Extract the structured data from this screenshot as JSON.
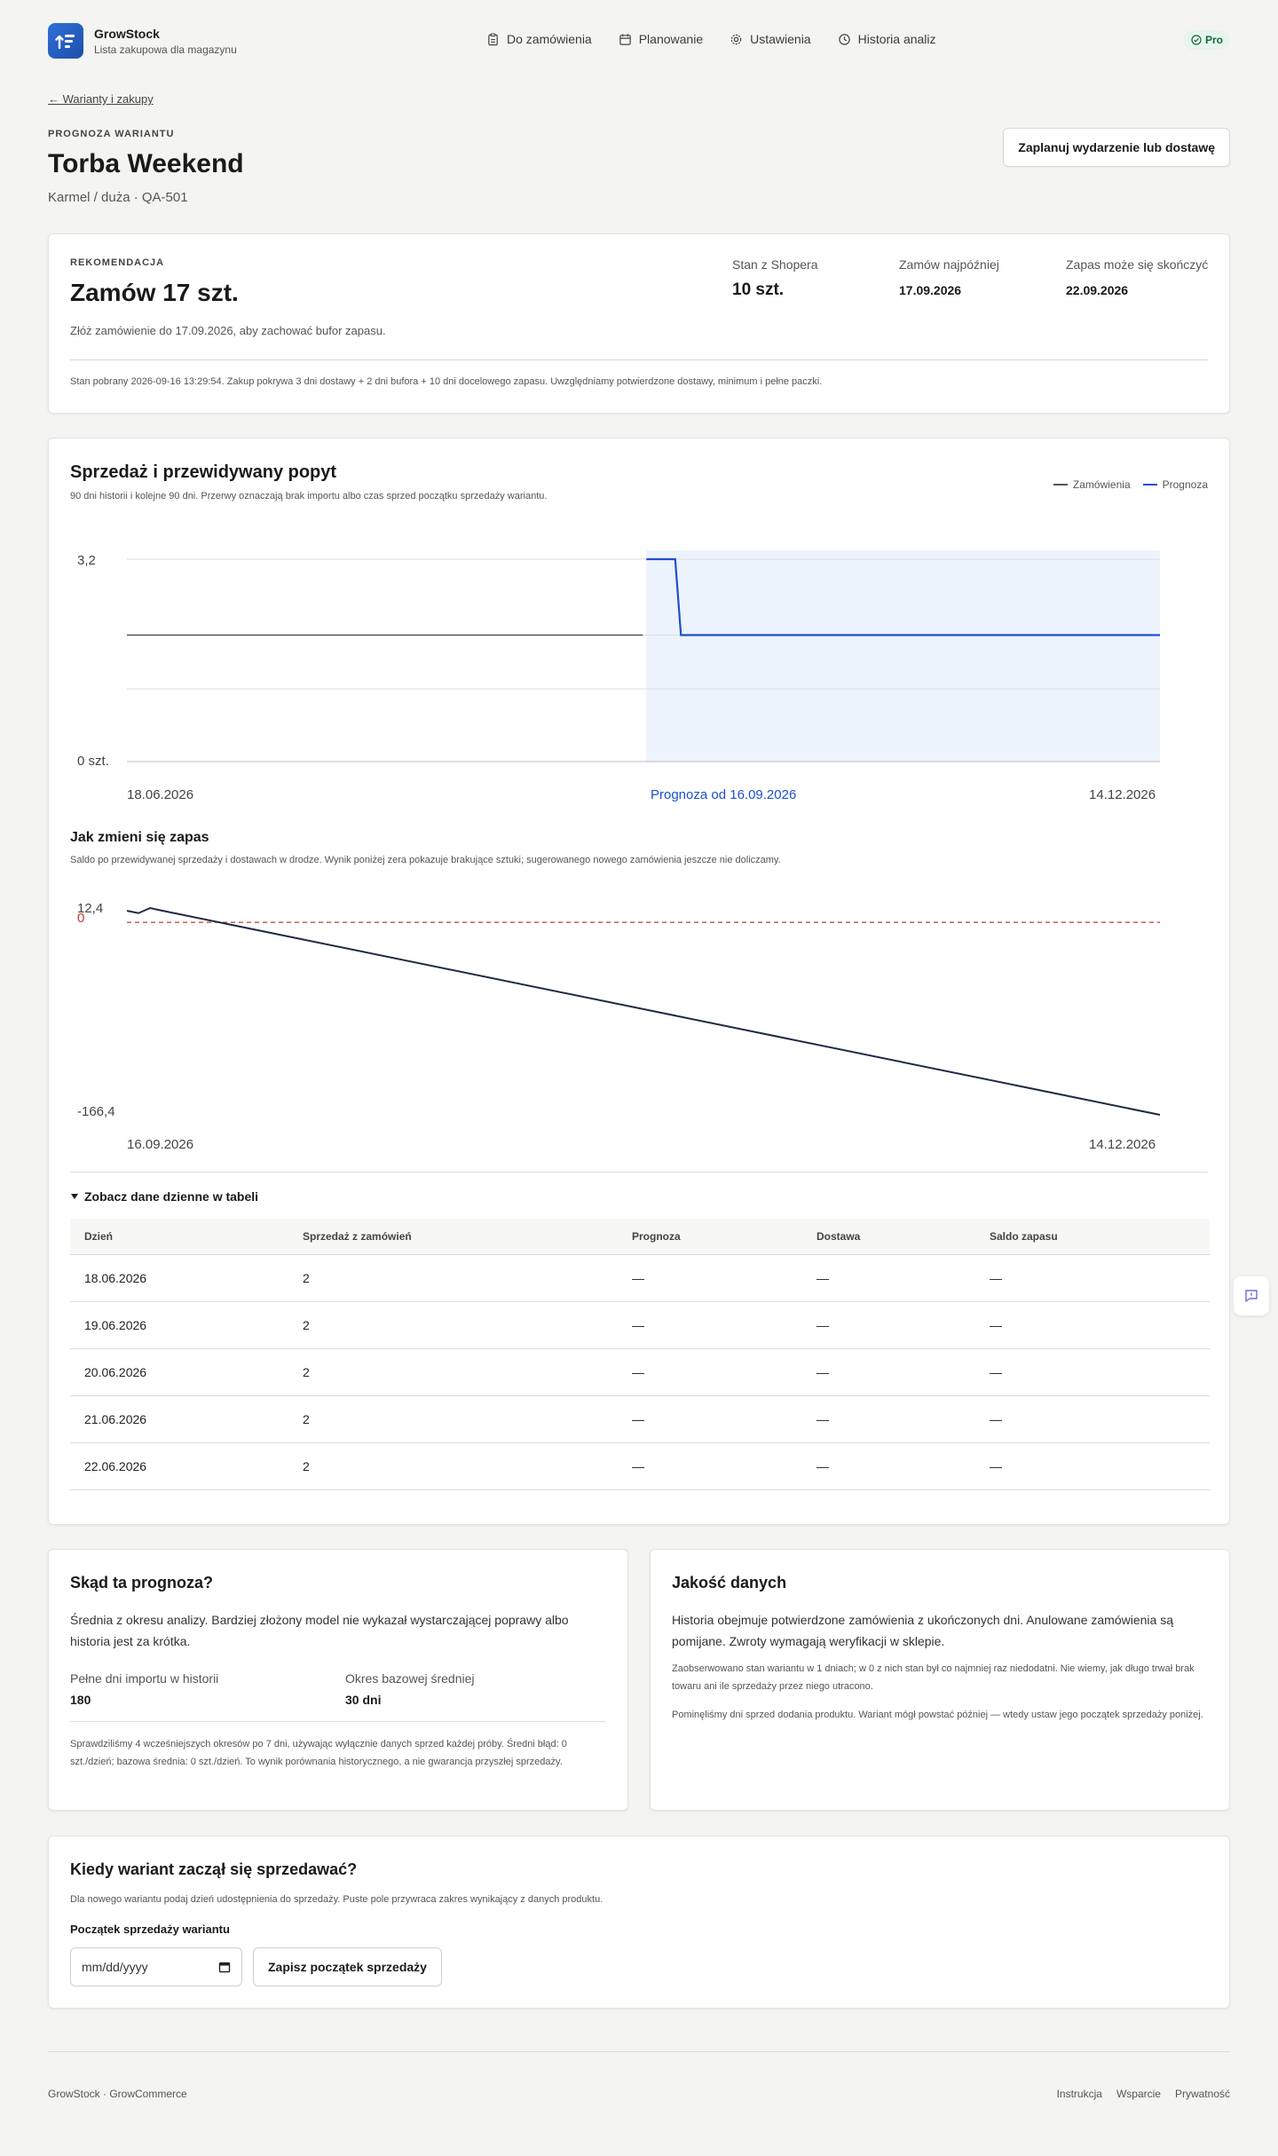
{
  "brand": {
    "name": "GrowStock",
    "tagline": "Lista zakupowa dla magazynu"
  },
  "nav": [
    {
      "label": "Do zamówienia",
      "icon": "clipboard-icon"
    },
    {
      "label": "Planowanie",
      "icon": "calendar-icon"
    },
    {
      "label": "Ustawienia",
      "icon": "gear-icon"
    },
    {
      "label": "Historia analiz",
      "icon": "clock-icon"
    }
  ],
  "plan_badge": "Pro",
  "back_link": "← Warianty i zakupy",
  "header": {
    "eyebrow": "PROGNOZA WARIANTU",
    "title": "Torba Weekend",
    "subtitle": "Karmel / duża · QA-501",
    "schedule_button": "Zaplanuj wydarzenie lub dostawę"
  },
  "recommendation": {
    "eyebrow": "REKOMENDACJA",
    "value": "Zamów 17 szt.",
    "note": "Złóż zamówienie do 17.09.2026, aby zachować bufor zapasu.",
    "stats": [
      {
        "label": "Stan z Shopera",
        "value": "10 szt."
      },
      {
        "label": "Zamów najpóźniej",
        "value": "17.09.2026"
      },
      {
        "label": "Zapas może się skończyć",
        "value": "22.09.2026"
      }
    ],
    "footnote": "Stan pobrany 2026-09-16 13:29:54. Zakup pokrywa 3 dni dostawy + 2 dni bufora + 10 dni docelowego zapasu. Uwzględniamy potwierdzone dostawy, minimum i pełne paczki."
  },
  "sales_chart": {
    "title": "Sprzedaż i przewidywany popyt",
    "subtitle": "90 dni historii i kolejne 90 dni. Przerwy oznaczają brak importu albo czas sprzed początku sprzedaży wariantu.",
    "legend": {
      "orders": "Zamówienia",
      "forecast": "Prognoza"
    },
    "y_top_label": "3,2",
    "y_bottom_label": "0 szt.",
    "x_start_label": "18.06.2026",
    "x_forecast_label": "Prognoza od 16.09.2026",
    "x_end_label": "14.12.2026",
    "colors": {
      "orders": "#555555",
      "forecast": "#1d4fcf",
      "forecast_bg": "#edf3fd"
    }
  },
  "stock_chart": {
    "title": "Jak zmieni się zapas",
    "subtitle": "Saldo po przewidywanej sprzedaży i dostawach w drodze. Wynik poniżej zera pokazuje brakujące sztuki; sugerowanego nowego zamówienia jeszcze nie doliczamy.",
    "y_top_label": "12,4",
    "y_zero_label": "0",
    "y_bottom_label": "-166,4",
    "x_start_label": "16.09.2026",
    "x_end_label": "14.12.2026",
    "colors": {
      "line": "#1e2a44",
      "zero": "#c0392b"
    }
  },
  "chart_data": [
    {
      "type": "line",
      "title": "Sprzedaż i przewidywany popyt",
      "x": [
        "18.06.2026",
        "16.09.2026",
        "14.12.2026"
      ],
      "series": [
        {
          "name": "Zamówienia",
          "x": [
            "18.06.2026",
            "16.09.2026"
          ],
          "values": [
            2,
            2
          ]
        },
        {
          "name": "Prognoza",
          "x": [
            "16.09.2026",
            "21.09.2026",
            "22.09.2026",
            "14.12.2026"
          ],
          "values": [
            3.2,
            3.2,
            2,
            2
          ]
        }
      ],
      "ylim": [
        0,
        3.2
      ],
      "grid": true,
      "legend": "top-right"
    },
    {
      "type": "line",
      "title": "Jak zmieni się zapas",
      "x": [
        "16.09.2026",
        "17.09.2026",
        "18.09.2026",
        "19.09.2026",
        "14.12.2026"
      ],
      "series": [
        {
          "name": "Saldo zapasu",
          "values": [
            10,
            8,
            12.4,
            10.2,
            -166.4
          ]
        }
      ],
      "ylim": [
        -166.4,
        12.4
      ],
      "reference_line": 0
    }
  ],
  "table": {
    "toggle_label": "Zobacz dane dzienne w tabeli",
    "columns": [
      "Dzień",
      "Sprzedaż z zamówień",
      "Prognoza",
      "Dostawa",
      "Saldo zapasu"
    ],
    "rows": [
      [
        "18.06.2026",
        "2",
        "—",
        "—",
        "—"
      ],
      [
        "19.06.2026",
        "2",
        "—",
        "—",
        "—"
      ],
      [
        "20.06.2026",
        "2",
        "—",
        "—",
        "—"
      ],
      [
        "21.06.2026",
        "2",
        "—",
        "—",
        "—"
      ],
      [
        "22.06.2026",
        "2",
        "—",
        "—",
        "—"
      ]
    ]
  },
  "source_card": {
    "title": "Skąd ta prognoza?",
    "text": "Średnia z okresu analizy. Bardziej złożony model nie wykazał wystarczającej poprawy albo historia jest za krótka.",
    "kv": [
      {
        "label": "Pełne dni importu w historii",
        "value": "180"
      },
      {
        "label": "Okres bazowej średniej",
        "value": "30 dni"
      }
    ],
    "note": "Sprawdziliśmy 4 wcześniejszych okresów po 7 dni, używając wyłącznie danych sprzed każdej próby. Średni błąd: 0 szt./dzień; bazowa średnia: 0 szt./dzień. To wynik porównania historycznego, a nie gwarancja przyszłej sprzedaży."
  },
  "quality_card": {
    "title": "Jakość danych",
    "text": "Historia obejmuje potwierdzone zamówienia z ukończonych dni. Anulowane zamówienia są pomijane. Zwroty wymagają weryfikacji w sklepie.",
    "note1": "Zaobserwowano stan wariantu w 1 dniach; w 0 z nich stan był co najmniej raz niedodatni. Nie wiemy, jak długo trwał brak towaru ani ile sprzedaży przez niego utracono.",
    "note2": "Pominęliśmy dni sprzed dodania produktu. Wariant mógł powstać później — wtedy ustaw jego początek sprzedaży poniżej."
  },
  "sale_start": {
    "title": "Kiedy wariant zaczął się sprzedawać?",
    "subtitle": "Dla nowego wariantu podaj dzień udostępnienia do sprzedaży. Puste pole przywraca zakres wynikający z danych produktu.",
    "field_label": "Początek sprzedaży wariantu",
    "placeholder": "mm/dd/yyyy",
    "save_button": "Zapisz początek sprzedaży"
  },
  "footer": {
    "left": "GrowStock · GrowCommerce",
    "links": [
      "Instrukcja",
      "Wsparcie",
      "Prywatność"
    ]
  }
}
